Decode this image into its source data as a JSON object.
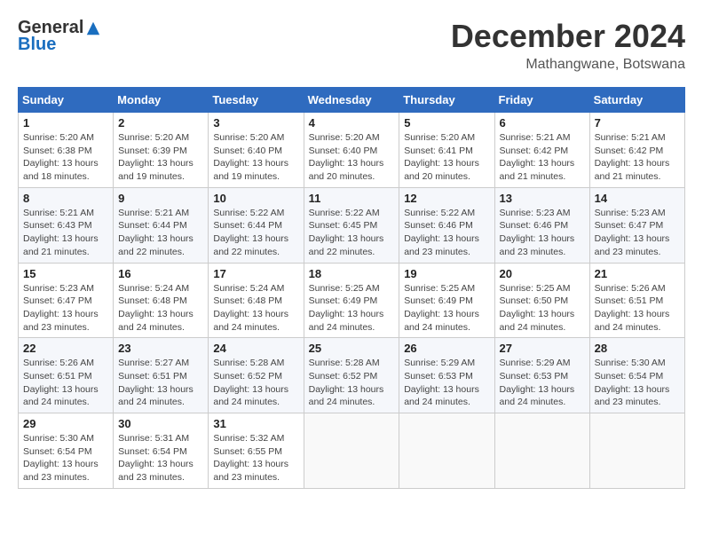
{
  "header": {
    "logo_general": "General",
    "logo_blue": "Blue",
    "title": "December 2024",
    "location": "Mathangwane, Botswana"
  },
  "days_of_week": [
    "Sunday",
    "Monday",
    "Tuesday",
    "Wednesday",
    "Thursday",
    "Friday",
    "Saturday"
  ],
  "weeks": [
    [
      {
        "day": "1",
        "sunrise": "5:20 AM",
        "sunset": "6:38 PM",
        "daylight": "13 hours and 18 minutes."
      },
      {
        "day": "2",
        "sunrise": "5:20 AM",
        "sunset": "6:39 PM",
        "daylight": "13 hours and 19 minutes."
      },
      {
        "day": "3",
        "sunrise": "5:20 AM",
        "sunset": "6:40 PM",
        "daylight": "13 hours and 19 minutes."
      },
      {
        "day": "4",
        "sunrise": "5:20 AM",
        "sunset": "6:40 PM",
        "daylight": "13 hours and 20 minutes."
      },
      {
        "day": "5",
        "sunrise": "5:20 AM",
        "sunset": "6:41 PM",
        "daylight": "13 hours and 20 minutes."
      },
      {
        "day": "6",
        "sunrise": "5:21 AM",
        "sunset": "6:42 PM",
        "daylight": "13 hours and 21 minutes."
      },
      {
        "day": "7",
        "sunrise": "5:21 AM",
        "sunset": "6:42 PM",
        "daylight": "13 hours and 21 minutes."
      }
    ],
    [
      {
        "day": "8",
        "sunrise": "5:21 AM",
        "sunset": "6:43 PM",
        "daylight": "13 hours and 21 minutes."
      },
      {
        "day": "9",
        "sunrise": "5:21 AM",
        "sunset": "6:44 PM",
        "daylight": "13 hours and 22 minutes."
      },
      {
        "day": "10",
        "sunrise": "5:22 AM",
        "sunset": "6:44 PM",
        "daylight": "13 hours and 22 minutes."
      },
      {
        "day": "11",
        "sunrise": "5:22 AM",
        "sunset": "6:45 PM",
        "daylight": "13 hours and 22 minutes."
      },
      {
        "day": "12",
        "sunrise": "5:22 AM",
        "sunset": "6:46 PM",
        "daylight": "13 hours and 23 minutes."
      },
      {
        "day": "13",
        "sunrise": "5:23 AM",
        "sunset": "6:46 PM",
        "daylight": "13 hours and 23 minutes."
      },
      {
        "day": "14",
        "sunrise": "5:23 AM",
        "sunset": "6:47 PM",
        "daylight": "13 hours and 23 minutes."
      }
    ],
    [
      {
        "day": "15",
        "sunrise": "5:23 AM",
        "sunset": "6:47 PM",
        "daylight": "13 hours and 23 minutes."
      },
      {
        "day": "16",
        "sunrise": "5:24 AM",
        "sunset": "6:48 PM",
        "daylight": "13 hours and 24 minutes."
      },
      {
        "day": "17",
        "sunrise": "5:24 AM",
        "sunset": "6:48 PM",
        "daylight": "13 hours and 24 minutes."
      },
      {
        "day": "18",
        "sunrise": "5:25 AM",
        "sunset": "6:49 PM",
        "daylight": "13 hours and 24 minutes."
      },
      {
        "day": "19",
        "sunrise": "5:25 AM",
        "sunset": "6:49 PM",
        "daylight": "13 hours and 24 minutes."
      },
      {
        "day": "20",
        "sunrise": "5:25 AM",
        "sunset": "6:50 PM",
        "daylight": "13 hours and 24 minutes."
      },
      {
        "day": "21",
        "sunrise": "5:26 AM",
        "sunset": "6:51 PM",
        "daylight": "13 hours and 24 minutes."
      }
    ],
    [
      {
        "day": "22",
        "sunrise": "5:26 AM",
        "sunset": "6:51 PM",
        "daylight": "13 hours and 24 minutes."
      },
      {
        "day": "23",
        "sunrise": "5:27 AM",
        "sunset": "6:51 PM",
        "daylight": "13 hours and 24 minutes."
      },
      {
        "day": "24",
        "sunrise": "5:28 AM",
        "sunset": "6:52 PM",
        "daylight": "13 hours and 24 minutes."
      },
      {
        "day": "25",
        "sunrise": "5:28 AM",
        "sunset": "6:52 PM",
        "daylight": "13 hours and 24 minutes."
      },
      {
        "day": "26",
        "sunrise": "5:29 AM",
        "sunset": "6:53 PM",
        "daylight": "13 hours and 24 minutes."
      },
      {
        "day": "27",
        "sunrise": "5:29 AM",
        "sunset": "6:53 PM",
        "daylight": "13 hours and 24 minutes."
      },
      {
        "day": "28",
        "sunrise": "5:30 AM",
        "sunset": "6:54 PM",
        "daylight": "13 hours and 23 minutes."
      }
    ],
    [
      {
        "day": "29",
        "sunrise": "5:30 AM",
        "sunset": "6:54 PM",
        "daylight": "13 hours and 23 minutes."
      },
      {
        "day": "30",
        "sunrise": "5:31 AM",
        "sunset": "6:54 PM",
        "daylight": "13 hours and 23 minutes."
      },
      {
        "day": "31",
        "sunrise": "5:32 AM",
        "sunset": "6:55 PM",
        "daylight": "13 hours and 23 minutes."
      },
      null,
      null,
      null,
      null
    ]
  ]
}
